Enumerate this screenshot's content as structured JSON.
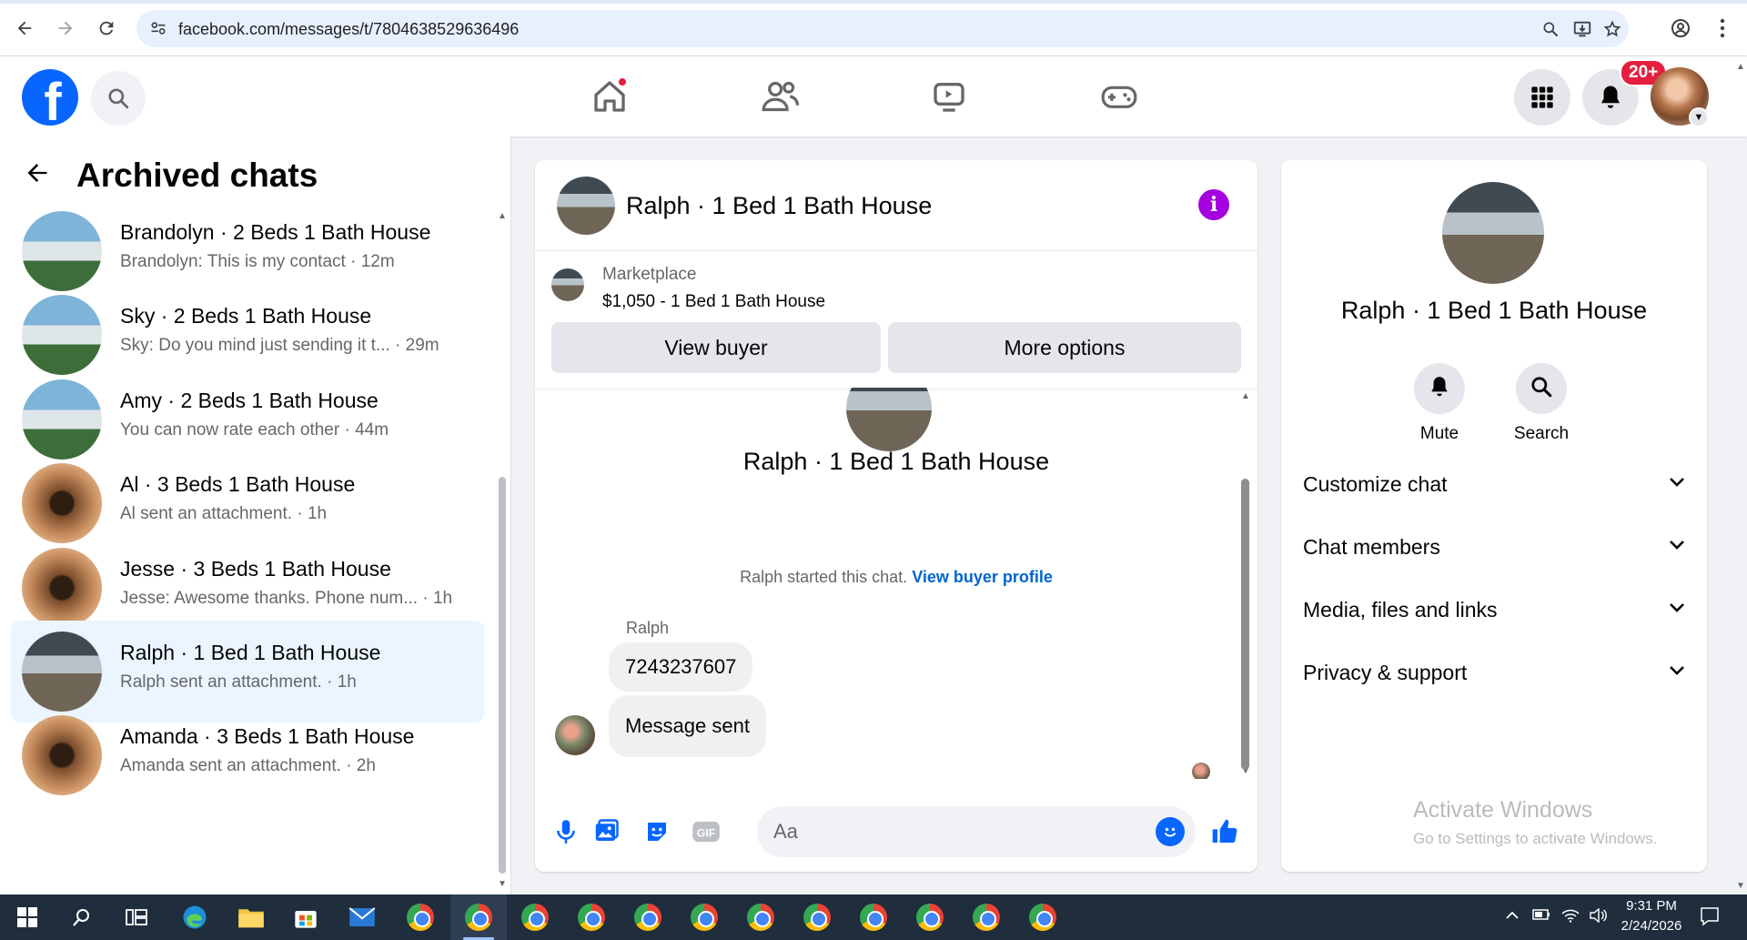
{
  "browser": {
    "url": "facebook.com/messages/t/7804638529636496"
  },
  "header": {
    "notifications_badge": "20+"
  },
  "left": {
    "title": "Archived chats",
    "chats": [
      {
        "name": "Brandolyn · 2 Beds 1 Bath House",
        "preview": "Brandolyn: This is my contact · 12m",
        "avatar": "house"
      },
      {
        "name": "Sky · 2 Beds 1 Bath House",
        "preview": "Sky: Do you mind just sending it t... · 29m",
        "avatar": "house"
      },
      {
        "name": "Amy · 2 Beds 1 Bath House",
        "preview": "You can now rate each other · 44m",
        "avatar": "house"
      },
      {
        "name": "Al · 3 Beds 1 Bath House",
        "preview": "Al sent an attachment. · 1h",
        "avatar": "hall"
      },
      {
        "name": "Jesse · 3 Beds 1 Bath House",
        "preview": "Jesse: Awesome thanks. Phone num... · 1h",
        "avatar": "hall"
      },
      {
        "name": "Ralph · 1 Bed 1 Bath House",
        "preview": "Ralph sent an attachment. · 1h",
        "avatar": "room",
        "active": true
      },
      {
        "name": "Amanda · 3 Beds 1 Bath House",
        "preview": "Amanda sent an attachment. · 2h",
        "avatar": "hall"
      }
    ]
  },
  "conversation": {
    "title": "Ralph · 1 Bed 1 Bath House",
    "marketplace_label": "Marketplace",
    "listing": "$1,050 - 1 Bed 1 Bath House",
    "view_buyer": "View buyer",
    "more_options": "More options",
    "started_text": "Ralph started this chat.",
    "buyer_profile_link": "View buyer profile",
    "sender": "Ralph",
    "messages": [
      "7243237607",
      "Message sent"
    ],
    "composer_placeholder": "Aa"
  },
  "details": {
    "name": "Ralph · 1 Bed 1 Bath House",
    "mute": "Mute",
    "search": "Search",
    "sections": [
      "Customize chat",
      "Chat members",
      "Media, files and links",
      "Privacy & support"
    ]
  },
  "watermark": {
    "title": "Activate Windows",
    "subtitle": "Go to Settings to activate Windows."
  },
  "taskbar": {
    "time": "9:31 PM",
    "date": "2/24/2026"
  },
  "colors": {
    "facebook_blue": "#0866ff",
    "active_chat": "#ebf5ff",
    "info_purple": "#a400e0",
    "badge_red": "#e41e3f",
    "link_blue": "#0064d1"
  },
  "icons": [
    "back-arrow-icon",
    "forward-arrow-icon",
    "reload-icon",
    "site-settings-icon",
    "zoom-icon",
    "install-icon",
    "bookmark-star-icon",
    "account-icon",
    "menu-dots-icon",
    "search-icon",
    "home-icon",
    "friends-icon",
    "video-icon",
    "gaming-icon",
    "apps-grid-icon",
    "bell-icon",
    "info-icon",
    "microphone-icon",
    "image-icon",
    "sticker-icon",
    "gif-icon",
    "emoji-icon",
    "like-icon",
    "chevron-down-icon",
    "windows-start-icon",
    "chrome-icon"
  ]
}
